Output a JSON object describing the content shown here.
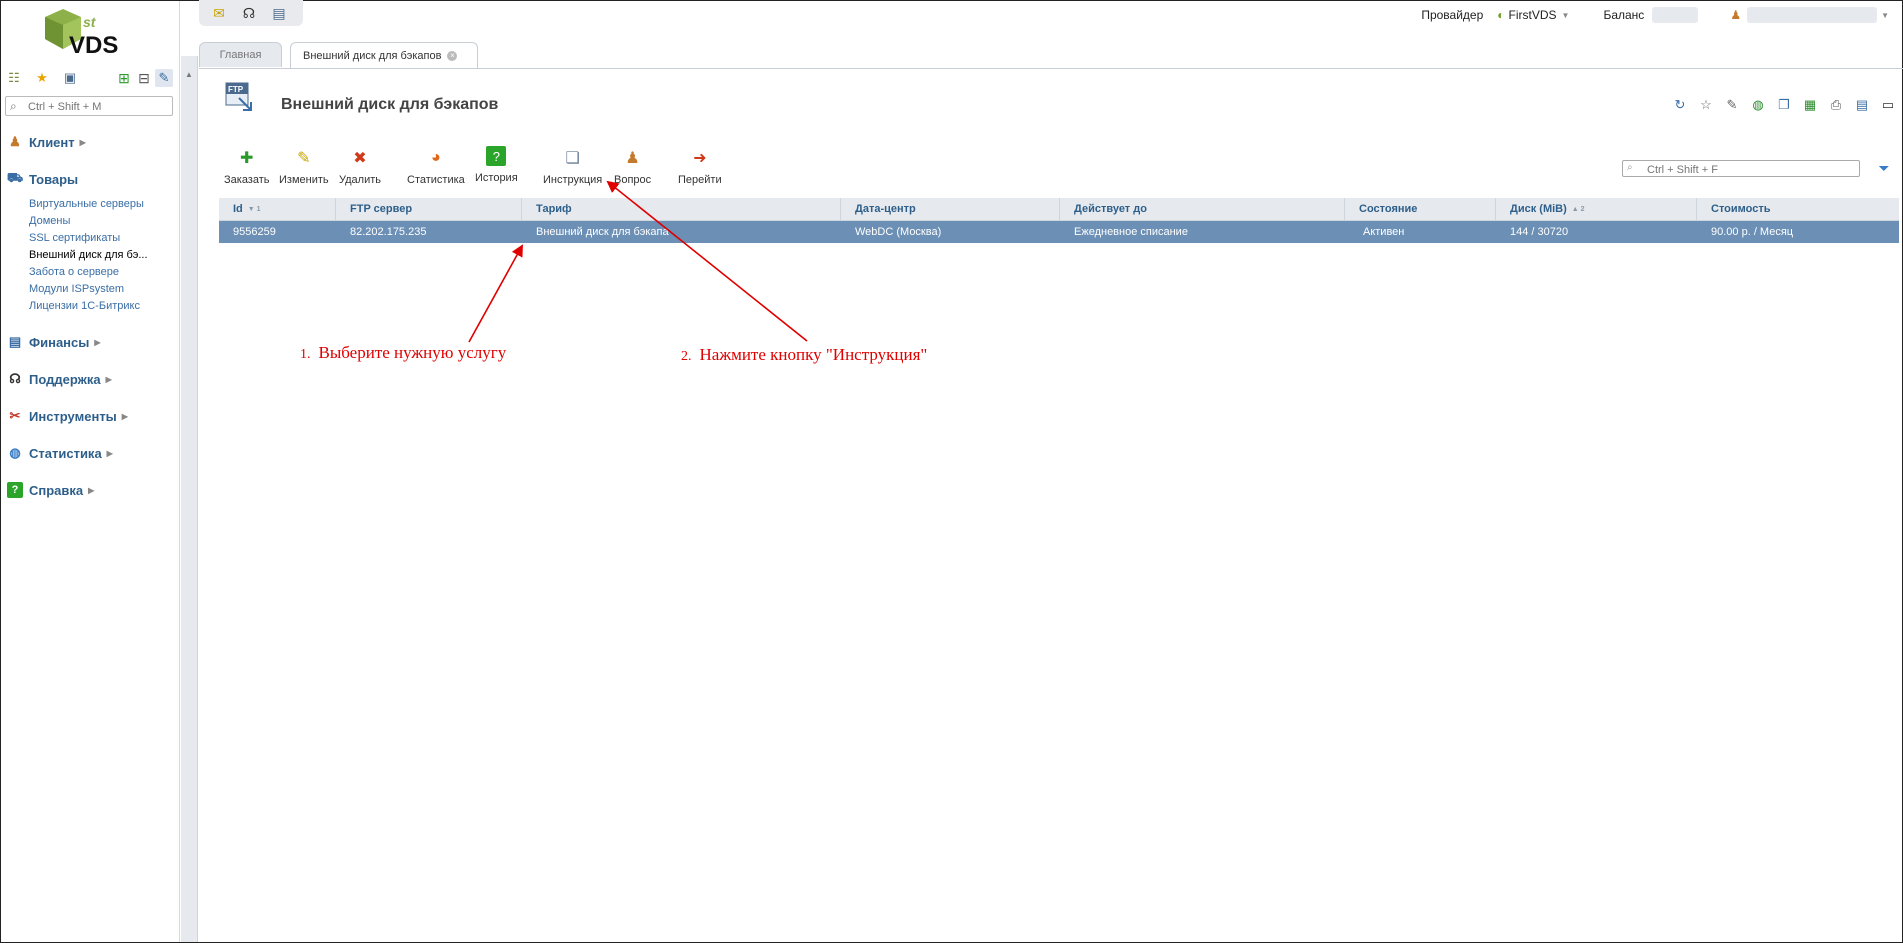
{
  "logo": {
    "text": "VDS",
    "superscript": "st"
  },
  "sidebar": {
    "search_placeholder": "Ctrl + Shift + M",
    "groups": [
      {
        "label": "Клиент"
      },
      {
        "label": "Товары"
      },
      {
        "label": "Финансы"
      },
      {
        "label": "Поддержка"
      },
      {
        "label": "Инструменты"
      },
      {
        "label": "Статистика"
      },
      {
        "label": "Справка"
      }
    ],
    "goods_items": [
      {
        "label": "Виртуальные серверы"
      },
      {
        "label": "Домены"
      },
      {
        "label": "SSL сертификаты"
      },
      {
        "label": "Внешний диск для бэ..."
      },
      {
        "label": "Забота о сервере"
      },
      {
        "label": "Модули ISPsystem"
      },
      {
        "label": "Лицензии 1С-Битрикс"
      }
    ]
  },
  "header": {
    "provider_label": "Провайдер",
    "provider_value": "FirstVDS",
    "balance_label": "Баланс"
  },
  "tabs": [
    {
      "label": "Главная"
    },
    {
      "label": "Внешний диск для бэкапов"
    }
  ],
  "page": {
    "title": "Внешний диск для бэкапов",
    "icon_text": "FTP",
    "filter_placeholder": "Ctrl + Shift + F"
  },
  "toolbar": [
    {
      "label": "Заказать"
    },
    {
      "label": "Изменить"
    },
    {
      "label": "Удалить"
    },
    {
      "label": "Статистика"
    },
    {
      "label": "История"
    },
    {
      "label": "Инструкция"
    },
    {
      "label": "Вопрос"
    },
    {
      "label": "Перейти"
    }
  ],
  "table": {
    "columns": [
      {
        "label": "Id",
        "sort": "▼ 1"
      },
      {
        "label": "FTP сервер",
        "sort": ""
      },
      {
        "label": "Тариф",
        "sort": ""
      },
      {
        "label": "Дата-центр",
        "sort": ""
      },
      {
        "label": "Действует до",
        "sort": ""
      },
      {
        "label": "Состояние",
        "sort": ""
      },
      {
        "label": "Диск (MiB)",
        "sort": "▲ 2"
      },
      {
        "label": "Стоимость",
        "sort": ""
      }
    ],
    "rows": [
      {
        "id": "9556259",
        "ftp": "82.202.175.235",
        "tariff": "Внешний диск для бэкапа",
        "dc": "WebDC (Москва)",
        "until": "Ежедневное списание",
        "state": "Активен",
        "disk": "144 / 30720",
        "cost": "90.00 р. / Месяц"
      }
    ]
  },
  "annotations": {
    "step1_num": "1.",
    "step1_text": "Выберите нужную услугу",
    "step2_num": "2.",
    "step2_text": "Нажмите кнопку \"Инструкция\"",
    "color": "#e00000"
  },
  "colors": {
    "selected_row": "#6b8fb5",
    "link": "#3a6ea5",
    "header_bg": "#e6eaef"
  }
}
